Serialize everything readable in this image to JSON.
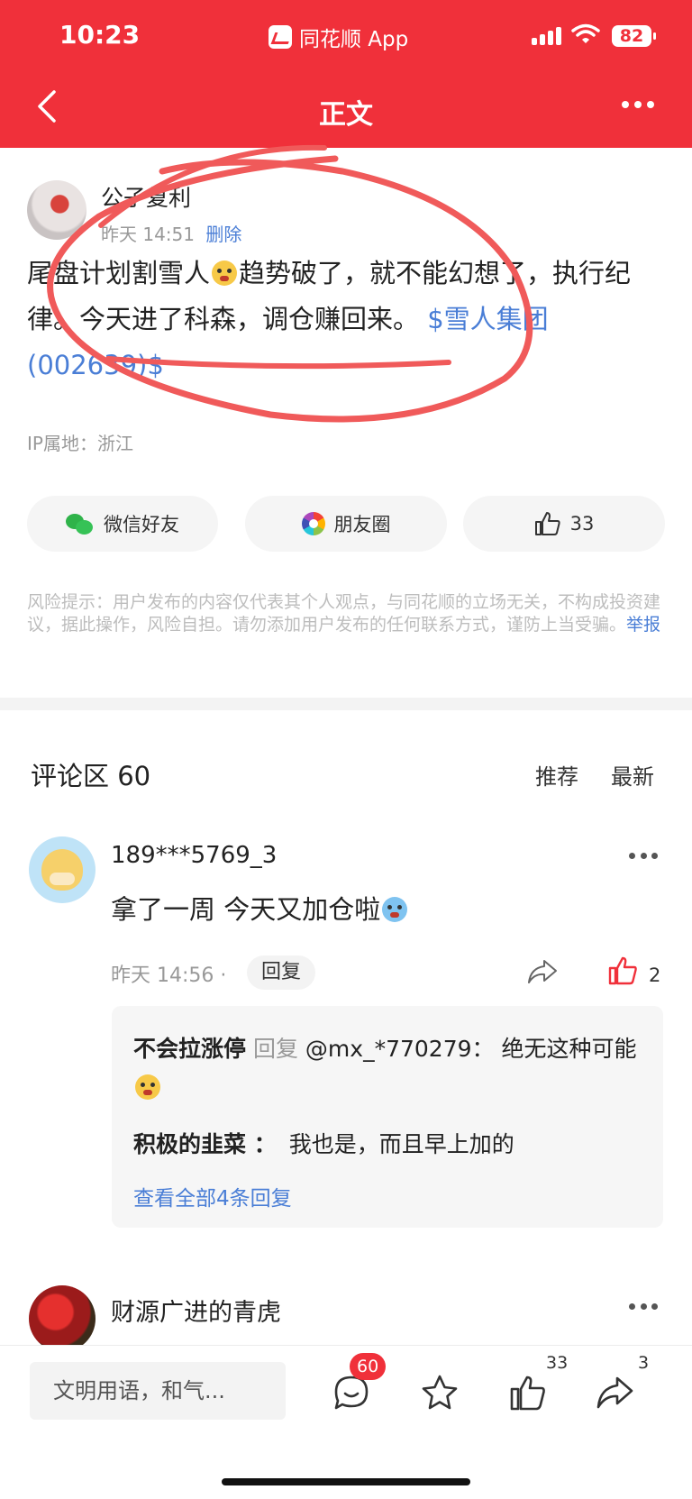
{
  "status": {
    "time": "10:23",
    "app_name": "同花顺 App",
    "battery": "82"
  },
  "nav": {
    "title": "正文"
  },
  "post": {
    "author": "公子复利",
    "time": "昨天 14:51",
    "delete_label": "删除",
    "text_part1": "尾盘计划割雪人",
    "text_part2": "趋势破了，就不能幻想了，执行纪律。今天进了科森，调仓赚回来。 ",
    "stock_tag": "$雪人集团(002639)$",
    "ip_label": "IP属地：浙江"
  },
  "share": {
    "wechat": "微信好友",
    "moments": "朋友圈",
    "like_count": "33"
  },
  "risk": {
    "text": "风险提示：用户发布的内容仅代表其个人观点，与同花顺的立场无关，不构成投资建议，据此操作，风险自担。请勿添加用户发布的任何联系方式，谨防上当受骗。",
    "report_label": "举报"
  },
  "comments": {
    "title": "评论区 60",
    "sort_recommend": "推荐",
    "sort_latest": "最新",
    "first": {
      "user": "189***5769_3",
      "text": "拿了一周 今天又加仓啦",
      "time": "昨天 14:56",
      "reply_label": "回复",
      "like_count": "2",
      "replies": [
        {
          "user": "不会拉涨停",
          "reply_word": " 回复 ",
          "target": "@mx_*770279：",
          "text": " 绝无这种可能"
        },
        {
          "user": "积极的韭菜 ：",
          "text": "我也是，而且早上加的"
        }
      ],
      "view_all": "查看全部4条回复"
    },
    "second": {
      "user": "财源广进的青虎"
    }
  },
  "bottom": {
    "input_placeholder": "文明用语，和气...",
    "comment_badge": "60",
    "like_sup": "33",
    "share_sup": "3"
  },
  "colors": {
    "brand_red": "#f0303a",
    "link_blue": "#4a7ed6",
    "annotation_red": "#f05a5a"
  }
}
